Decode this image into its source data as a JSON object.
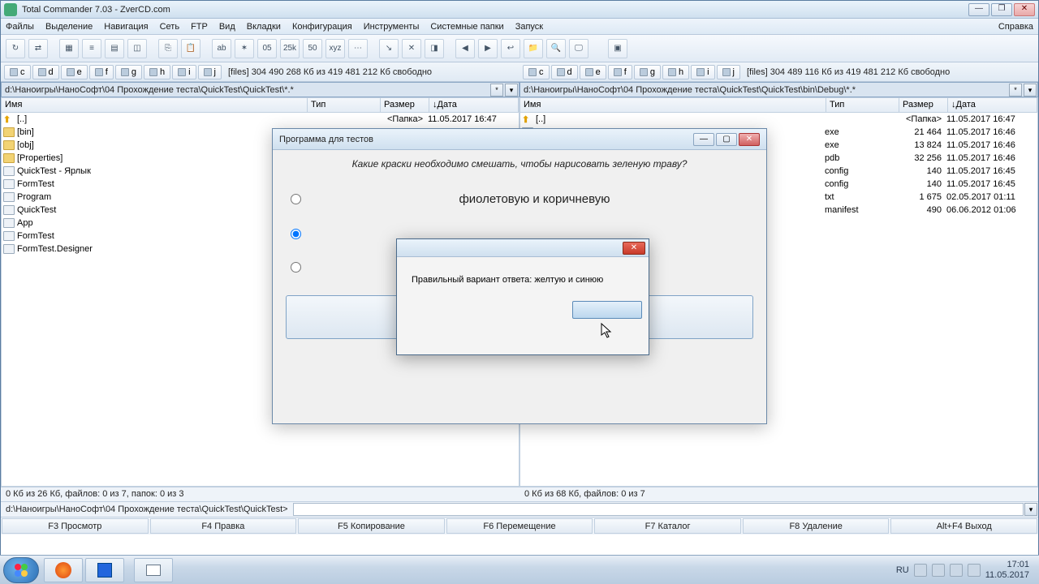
{
  "window": {
    "title": "Total Commander 7.03 - ZverCD.com"
  },
  "menu": {
    "files": "Файлы",
    "select": "Выделение",
    "nav": "Навигация",
    "net": "Сеть",
    "ftp": "FTP",
    "view": "Вид",
    "tabs": "Вкладки",
    "config": "Конфигурация",
    "tools": "Инструменты",
    "sysfolders": "Системные папки",
    "run": "Запуск",
    "help": "Справка"
  },
  "drives": {
    "letters": [
      "c",
      "d",
      "e",
      "f",
      "g",
      "h",
      "i",
      "j"
    ],
    "left_info": "[files]   304 490 268 Кб из 419 481 212 Кб свободно",
    "right_info": "[files]   304 489 116 Кб из 419 481 212 Кб свободно"
  },
  "paths": {
    "left": "d:\\Наноигры\\НаноСофт\\04 Прохождение теста\\QuickTest\\QuickTest\\*.*",
    "right": "d:\\Наноигры\\НаноСофт\\04 Прохождение теста\\QuickTest\\QuickTest\\bin\\Debug\\*.*"
  },
  "cols": {
    "name": "Имя",
    "type": "Тип",
    "size": "Размер",
    "date": "↓Дата"
  },
  "left_rows": [
    {
      "kind": "up",
      "name": "[..]",
      "type": "",
      "size": "<Папка>",
      "date": "11.05.2017 16:47"
    },
    {
      "kind": "dir",
      "name": "[bin]"
    },
    {
      "kind": "dir",
      "name": "[obj]"
    },
    {
      "kind": "dir",
      "name": "[Properties]"
    },
    {
      "kind": "lnk",
      "name": "QuickTest - Ярлык"
    },
    {
      "kind": "file",
      "name": "FormTest"
    },
    {
      "kind": "file",
      "name": "Program"
    },
    {
      "kind": "file",
      "name": "QuickTest"
    },
    {
      "kind": "file",
      "name": "App"
    },
    {
      "kind": "file",
      "name": "FormTest"
    },
    {
      "kind": "file",
      "name": "FormTest.Designer"
    }
  ],
  "right_rows": [
    {
      "kind": "up",
      "name": "[..]",
      "type": "",
      "size": "<Папка>",
      "date": "11.05.2017 16:47"
    },
    {
      "kind": "file",
      "name": "",
      "type": "exe",
      "size": "21 464",
      "date": "11.05.2017 16:46"
    },
    {
      "kind": "file",
      "name": "",
      "type": "exe",
      "size": "13 824",
      "date": "11.05.2017 16:46"
    },
    {
      "kind": "file",
      "name": "",
      "type": "pdb",
      "size": "32 256",
      "date": "11.05.2017 16:46"
    },
    {
      "kind": "file",
      "name": "",
      "type": "config",
      "size": "140",
      "date": "11.05.2017 16:45"
    },
    {
      "kind": "file",
      "name": "",
      "type": "config",
      "size": "140",
      "date": "11.05.2017 16:45"
    },
    {
      "kind": "file",
      "name": "",
      "type": "txt",
      "size": "1 675",
      "date": "02.05.2017 01:11"
    },
    {
      "kind": "file",
      "name": "",
      "type": "manifest",
      "size": "490",
      "date": "06.06.2012 01:06"
    }
  ],
  "status": {
    "left": "0 Кб из 26 Кб, файлов: 0 из 7, папок: 0 из 3",
    "right": "0 Кб из 68 Кб, файлов: 0 из 7"
  },
  "cmdprompt": "d:\\Наноигры\\НаноСофт\\04 Прохождение теста\\QuickTest\\QuickTest>",
  "fnkeys": {
    "f3": "F3 Просмотр",
    "f4": "F4 Правка",
    "f5": "F5 Копирование",
    "f6": "F6 Перемещение",
    "f7": "F7 Каталог",
    "f8": "F8 Удаление",
    "altf4": "Alt+F4 Выход"
  },
  "dialog": {
    "title": "Программа для тестов",
    "question": "Какие краски необходимо смешать, чтобы нарисовать зеленую траву?",
    "opt1": "фиолетовую и коричневую",
    "opt2": "",
    "opt3": ""
  },
  "msgbox": {
    "text": "Правильный вариант ответа: желтую и синюю",
    "ok": ""
  },
  "tray": {
    "lang": "RU",
    "time": "17:01",
    "date": "11.05.2017"
  }
}
